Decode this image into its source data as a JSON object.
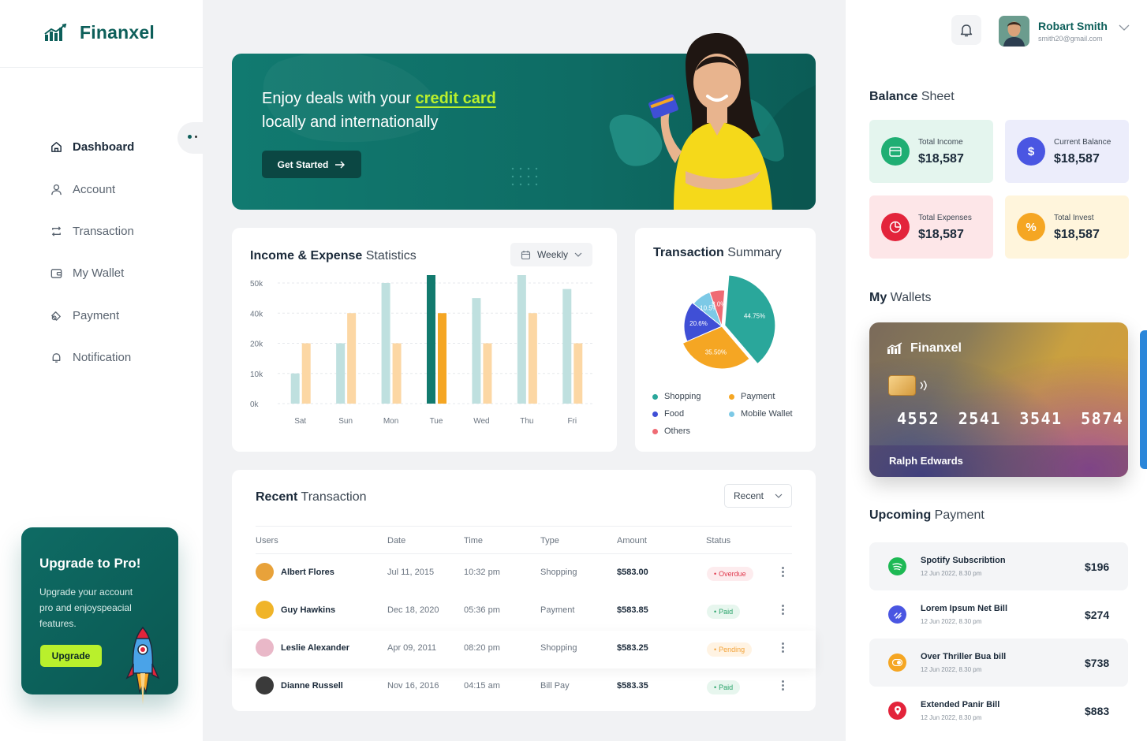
{
  "brand": {
    "name": "Finanxel"
  },
  "sidebar": {
    "items": [
      {
        "label": "Dashboard",
        "icon": "home-icon"
      },
      {
        "label": "Account",
        "icon": "user-icon"
      },
      {
        "label": "Transaction",
        "icon": "transfer-icon"
      },
      {
        "label": "My Wallet",
        "icon": "wallet-icon"
      },
      {
        "label": "Payment",
        "icon": "payment-icon"
      },
      {
        "label": "Notification",
        "icon": "bell-icon"
      }
    ],
    "upgrade": {
      "title": "Upgrade to Pro!",
      "text": "Upgrade your account pro and enjoyspeacial features.",
      "button": "Upgrade"
    }
  },
  "banner": {
    "line1_prefix": "Enjoy deals with your ",
    "line1_highlight": "credit card",
    "line2": "locally and internationally",
    "button": "Get Started",
    "accent": "#b9f02c"
  },
  "stats": {
    "title_bold": "Income & Expense",
    "title_rest": " Statistics",
    "period": "Weekly"
  },
  "chart_data": [
    {
      "type": "bar",
      "categories": [
        "Sat",
        "Sun",
        "Mon",
        "Tue",
        "Wed",
        "Thu",
        "Fri"
      ],
      "y_ticks": [
        "50k",
        "40k",
        "20k",
        "10k",
        "0k"
      ],
      "series": [
        {
          "color": "#bfe0df",
          "values": [
            1,
            2,
            4,
            4.5,
            3.5,
            4.5,
            3.8
          ],
          "highlight_index": 3,
          "highlight_color": "#127a6e"
        },
        {
          "color": "#fcd7a4",
          "values": [
            2,
            3,
            2,
            3,
            2,
            3,
            2
          ],
          "highlight_index": 3,
          "highlight_color": "#f5a623"
        }
      ],
      "grid": true
    },
    {
      "type": "pie",
      "slices": [
        {
          "label": "Shopping",
          "value": 44.75,
          "text": "44.75%",
          "color": "#2aa79b"
        },
        {
          "label": "Payment",
          "value": 35.5,
          "text": "35.50%",
          "color": "#f5a623"
        },
        {
          "label": "Food",
          "value": 20.6,
          "text": "20.6%",
          "color": "#3f4fd6"
        },
        {
          "label": "Mobile Wallet",
          "value": 10.5,
          "text": "10.5%",
          "color": "#7cc9e6"
        },
        {
          "label": "Others",
          "value": 8.0,
          "text": "8.0%",
          "color": "#ef6b74"
        }
      ]
    }
  ],
  "summary": {
    "title_bold": "Transaction",
    "title_rest": " Summary",
    "legend": [
      {
        "label": "Shopping",
        "color": "#2aa79b"
      },
      {
        "label": "Payment",
        "color": "#f5a623"
      },
      {
        "label": "Food",
        "color": "#3f4fd6"
      },
      {
        "label": "Mobile Wallet",
        "color": "#7cc9e6"
      },
      {
        "label": "Others",
        "color": "#ef6b74"
      }
    ]
  },
  "recent": {
    "title_bold": "Recent",
    "title_rest": " Transaction",
    "filter": "Recent",
    "columns": [
      "Users",
      "Date",
      "Time",
      "Type",
      "Amount",
      "Status"
    ],
    "rows": [
      {
        "user": "Albert Flores",
        "date": "Jul 11, 2015",
        "time": "10:32 pm",
        "type": "Shopping",
        "amount": "$583.00",
        "status": "Overdue",
        "avatar": "#e8a23a"
      },
      {
        "user": "Guy Hawkins",
        "date": "Dec 18, 2020",
        "time": "05:36 pm",
        "type": "Payment",
        "amount": "$583.85",
        "status": "Paid",
        "avatar": "#f0b429"
      },
      {
        "user": "Leslie Alexander",
        "date": "Apr 09, 2011",
        "time": "08:20 pm",
        "type": "Shopping",
        "amount": "$583.25",
        "status": "Pending",
        "avatar": "#e9b8c8"
      },
      {
        "user": "Dianne Russell",
        "date": "Nov 16, 2016",
        "time": "04:15 am",
        "type": "Bill Pay",
        "amount": "$583.35",
        "status": "Paid",
        "avatar": "#3a3a3a"
      }
    ]
  },
  "profile": {
    "name": "Robart Smith",
    "email": "smith20@gmail.com"
  },
  "balance": {
    "title_bold": "Balance",
    "title_rest": " Sheet",
    "items": [
      {
        "label": "Total Income",
        "value": "$18,587",
        "bg": "#e4f5ee",
        "icon_bg": "#1fae73",
        "icon": "card-icon"
      },
      {
        "label": "Current Balance",
        "value": "$18,587",
        "bg": "#ecedfb",
        "icon_bg": "#4a56e2",
        "icon": "dollar-icon"
      },
      {
        "label": "Total Expenses",
        "value": "$18,587",
        "bg": "#fde6e8",
        "icon_bg": "#e3243b",
        "icon": "pie-icon"
      },
      {
        "label": "Total Invest",
        "value": "$18,587",
        "bg": "#fff5dc",
        "icon_bg": "#f5a623",
        "icon": "percent-icon"
      }
    ]
  },
  "wallets": {
    "title_bold": "My",
    "title_rest": " Wallets",
    "card": {
      "brand": "Finanxel",
      "number": "4552 2541 3541 5874",
      "holder": "Ralph Edwards"
    }
  },
  "upcoming": {
    "title_bold": "Upcoming",
    "title_rest": " Payment",
    "items": [
      {
        "name": "Spotify Subscribtion",
        "date": "12 Jun 2022, 8.30 pm",
        "amount": "$196",
        "icon": "spotify-icon",
        "color": "#1db954"
      },
      {
        "name": "Lorem Ipsum Net Bill",
        "date": "12 Jun 2022, 8.30 pm",
        "amount": "$274",
        "icon": "net-icon",
        "color": "#4a56e2"
      },
      {
        "name": "Over Thriller Bua bill",
        "date": "12 Jun 2022, 8.30 pm",
        "amount": "$738",
        "icon": "toggle-icon",
        "color": "#f5a623"
      },
      {
        "name": "Extended Panir Bill",
        "date": "12 Jun 2022, 8.30 pm",
        "amount": "$883",
        "icon": "pin-icon",
        "color": "#e3243b"
      }
    ]
  }
}
